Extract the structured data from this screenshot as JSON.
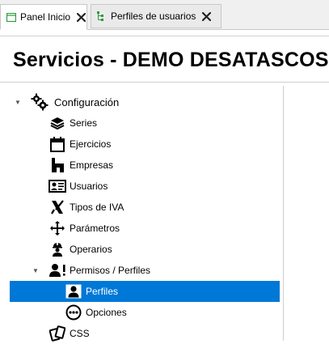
{
  "tabs": [
    {
      "label": "Panel Inicio",
      "icon": "window-icon",
      "active": true
    },
    {
      "label": "Perfiles de usuarios",
      "icon": "tree-list-icon",
      "active": false
    }
  ],
  "page_title": "Servicios - DEMO DESATASCOS",
  "tree": {
    "root": {
      "label": "Configuración",
      "icon": "gears-icon",
      "expanded": true
    },
    "items": [
      {
        "label": "Series",
        "icon": "layers-icon"
      },
      {
        "label": "Ejercicios",
        "icon": "calendar-icon"
      },
      {
        "label": "Empresas",
        "icon": "building-icon"
      },
      {
        "label": "Usuarios",
        "icon": "id-card-icon"
      },
      {
        "label": "Tipos de IVA",
        "icon": "tax-icon"
      },
      {
        "label": "Parámetros",
        "icon": "arrows-icon"
      },
      {
        "label": "Operarios",
        "icon": "worker-icon"
      },
      {
        "label": "Permisos / Perfiles",
        "icon": "user-alert-icon",
        "expanded": true
      },
      {
        "label": "Perfiles",
        "icon": "user-icon",
        "selected": true
      },
      {
        "label": "Opciones",
        "icon": "dots-circle-icon"
      },
      {
        "label": "CSS",
        "icon": "cards-icon"
      }
    ]
  },
  "colors": {
    "selected": "#0078d7",
    "tab_green": "#2e9a3e"
  }
}
